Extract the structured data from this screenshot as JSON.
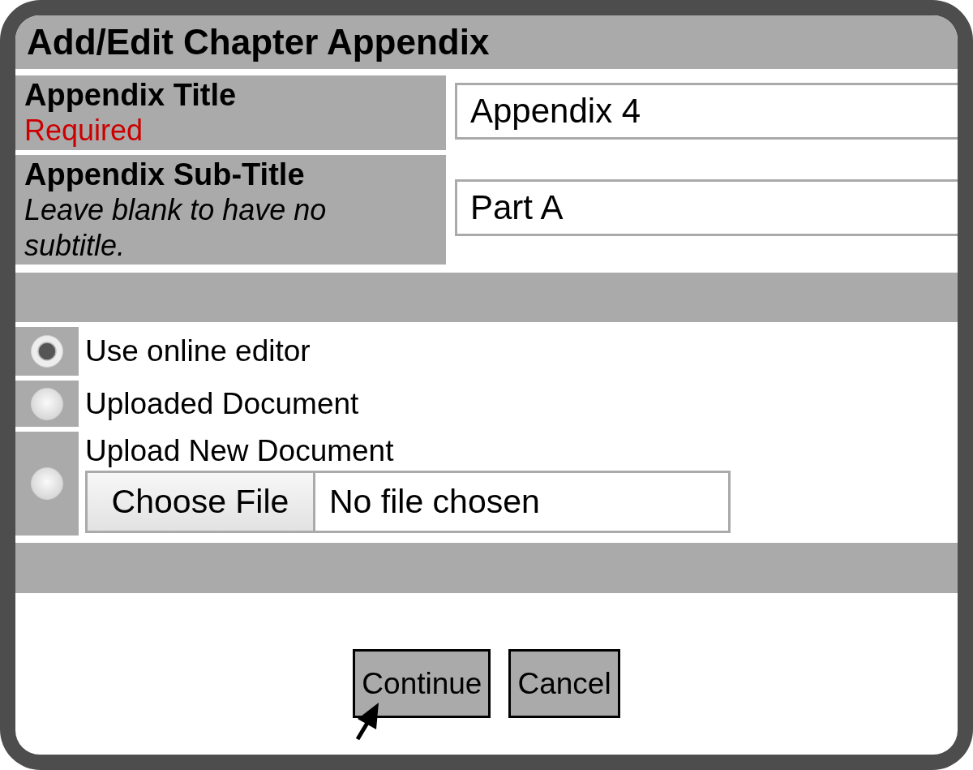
{
  "dialog": {
    "title": "Add/Edit Chapter Appendix"
  },
  "fields": [
    {
      "label": "Appendix Title",
      "hint": {
        "text": "Required",
        "kind": "required"
      },
      "value": "Appendix 4"
    },
    {
      "label": "Appendix Sub-Title",
      "hint": {
        "text": "Leave blank to have no subtitle.",
        "kind": "note"
      },
      "value": "Part A"
    }
  ],
  "content_options": [
    {
      "label": "Use online editor",
      "selected": true
    },
    {
      "label": "Uploaded Document",
      "selected": false
    },
    {
      "label": "Upload New Document",
      "selected": false,
      "file_input": {
        "button": "Choose File",
        "status": "No file chosen"
      }
    }
  ],
  "buttons": [
    {
      "label": "Continue",
      "hovered": true
    },
    {
      "label": "Cancel",
      "hovered": false
    }
  ]
}
